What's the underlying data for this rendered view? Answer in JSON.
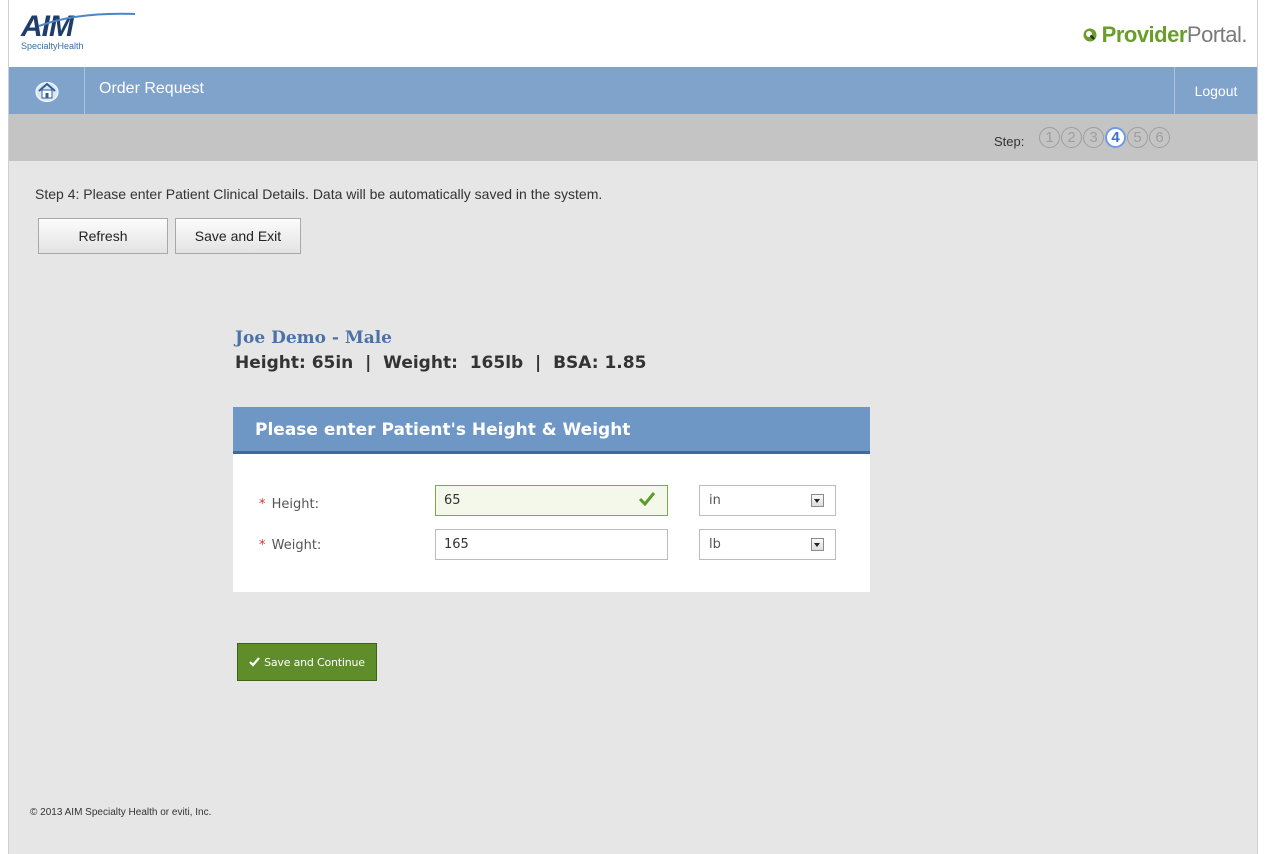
{
  "header": {
    "logo_main": "AIM",
    "logo_sub": "SpecialtyHealth",
    "portal_name_a": "Provider",
    "portal_name_b": "Portal."
  },
  "nav": {
    "home_icon": "home-icon",
    "title": "Order Request",
    "logout_label": "Logout"
  },
  "steps": {
    "label": "Step:",
    "items": [
      "1",
      "2",
      "3",
      "4",
      "5",
      "6"
    ],
    "current": "4"
  },
  "instruction": "Step 4:  Please enter Patient Clinical Details.  Data will be automatically saved in the system.",
  "buttons": {
    "refresh": "Refresh",
    "save_exit": "Save and Exit",
    "save_continue": "Save and Continue"
  },
  "patient": {
    "name_line": "Joe Demo  - Male",
    "metrics_line": "Height: 65in  |  Weight:  165lb  |  BSA: 1.85"
  },
  "form": {
    "title": "Please enter Patient's Height & Weight",
    "required_marker": "*",
    "height": {
      "label": "Height:",
      "value": "65",
      "unit": "in",
      "validated": true
    },
    "weight": {
      "label": "Weight:",
      "value": "165",
      "unit": "lb"
    }
  },
  "footer": "© 2013 AIM Specialty Health or eviti, Inc.",
  "colors": {
    "nav_blue": "#80a3cc",
    "card_header_blue": "#6e97c6",
    "accent_green": "#5f8d2a",
    "step_active": "#3a6fd8"
  }
}
